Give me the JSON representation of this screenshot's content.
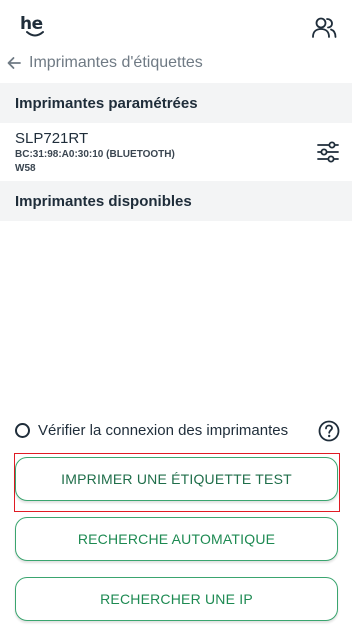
{
  "header": {
    "logo_text": "he",
    "users_icon": "users-icon"
  },
  "nav": {
    "back_icon": "arrow-left-icon",
    "title": "Imprimantes d'étiquettes"
  },
  "configured": {
    "heading": "Imprimantes paramétrées",
    "printers": [
      {
        "name": "SLP721RT",
        "address": "BC:31:98:A0:30:10 (BLUETOOTH)",
        "model": "W58",
        "action_icon": "settings-sliders-icon"
      }
    ]
  },
  "available": {
    "heading": "Imprimantes disponibles"
  },
  "check_connection": {
    "label": "Vérifier la connexion des imprimantes",
    "checked": false,
    "help_icon": "help-icon"
  },
  "buttons": {
    "print_test": "IMPRIMER UNE ÉTIQUETTE TEST",
    "auto_search": "RECHERCHE AUTOMATIQUE",
    "search_ip": "RECHERCHER UNE IP"
  },
  "colors": {
    "accent": "#3aa56f",
    "text": "#1f2d3a",
    "section_bg": "#f3f4f5",
    "highlight": "#e01b24"
  }
}
